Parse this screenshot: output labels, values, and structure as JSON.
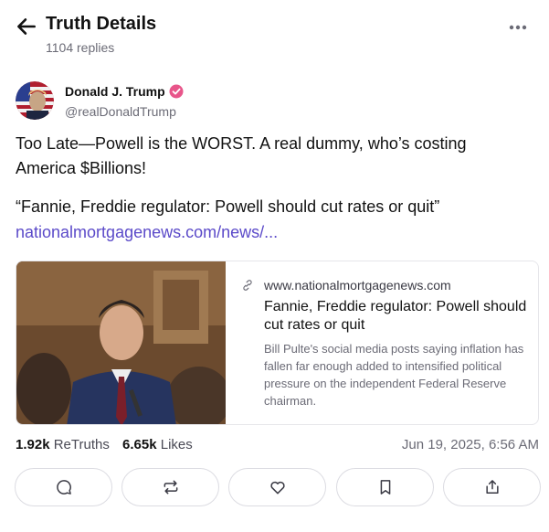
{
  "header": {
    "title": "Truth Details",
    "subtitle": "1104 replies"
  },
  "post": {
    "author_name": "Donald J. Trump",
    "author_handle": "@realDonaldTrump",
    "verified_color": "#e8558a",
    "body": "Too Late—Powell is the WORST. A real dummy, who’s costing America $Billions!",
    "quote": "“Fannie, Freddie regulator: Powell should cut rates or quit”",
    "link_text": "nationalmortgagenews.com/news/...",
    "link_color": "#5b4ac9"
  },
  "card": {
    "domain": "www.nationalmortgagenews.com",
    "title": "Fannie, Freddie regulator: Powell should cut rates or quit",
    "description": "Bill Pulte's social media posts saying inflation has fallen far enough added to intensified political pressure on the independent Federal Reserve chairman."
  },
  "stats": {
    "retruths_count": "1.92k",
    "retruths_label": "ReTruths",
    "likes_count": "6.65k",
    "likes_label": "Likes",
    "date": "Jun 19, 2025, 6:56 AM"
  },
  "actions": [
    "reply-icon",
    "retruth-icon",
    "like-icon",
    "bookmark-icon",
    "share-icon"
  ]
}
